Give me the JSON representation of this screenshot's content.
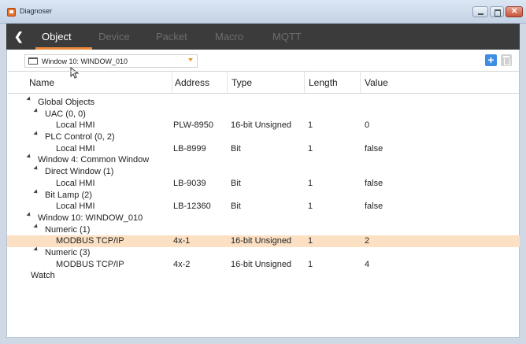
{
  "window": {
    "title": "Diagnoser"
  },
  "tabs": [
    {
      "label": "Object",
      "active": true
    },
    {
      "label": "Device",
      "active": false
    },
    {
      "label": "Packet",
      "active": false
    },
    {
      "label": "Macro",
      "active": false
    },
    {
      "label": "MQTT",
      "active": false
    }
  ],
  "window_select": {
    "value": "Window 10: WINDOW_010"
  },
  "columns": {
    "name": "Name",
    "address": "Address",
    "type": "Type",
    "length": "Length",
    "value": "Value"
  },
  "tree": [
    {
      "label": "Global Objects",
      "level": 0,
      "expander": true
    },
    {
      "label": "UAC (0, 0)",
      "level": 1,
      "expander": true
    },
    {
      "label": "Local HMI",
      "level": 2,
      "expander": false,
      "address": "PLW-8950",
      "type": "16-bit Unsigned",
      "length": "1",
      "value": "0"
    },
    {
      "label": "PLC Control (0, 2)",
      "level": 1,
      "expander": true
    },
    {
      "label": "Local HMI",
      "level": 2,
      "expander": false,
      "address": "LB-8999",
      "type": "Bit",
      "length": "1",
      "value": "false"
    },
    {
      "label": "Window 4: Common Window",
      "level": 0,
      "expander": true
    },
    {
      "label": "Direct Window (1)",
      "level": 1,
      "expander": true
    },
    {
      "label": "Local HMI",
      "level": 2,
      "expander": false,
      "address": "LB-9039",
      "type": "Bit",
      "length": "1",
      "value": "false"
    },
    {
      "label": "Bit Lamp (2)",
      "level": 1,
      "expander": true
    },
    {
      "label": "Local HMI",
      "level": 2,
      "expander": false,
      "address": "LB-12360",
      "type": "Bit",
      "length": "1",
      "value": "false"
    },
    {
      "label": "Window 10: WINDOW_010",
      "level": 0,
      "expander": true
    },
    {
      "label": "Numeric (1)",
      "level": 1,
      "expander": true
    },
    {
      "label": "MODBUS TCP/IP",
      "level": 2,
      "expander": false,
      "address": "4x-1",
      "type": "16-bit Unsigned",
      "length": "1",
      "value": "2",
      "selected": true
    },
    {
      "label": "Numeric (3)",
      "level": 1,
      "expander": true
    },
    {
      "label": "MODBUS TCP/IP",
      "level": 2,
      "expander": false,
      "address": "4x-2",
      "type": "16-bit Unsigned",
      "length": "1",
      "value": "4"
    },
    {
      "label": "Watch",
      "level": -1,
      "expander": false
    }
  ],
  "colors": {
    "accent": "#e8863a",
    "selection": "#fbe0c3",
    "add_button": "#3d8ee0",
    "tabbar": "#3b3b3b"
  }
}
